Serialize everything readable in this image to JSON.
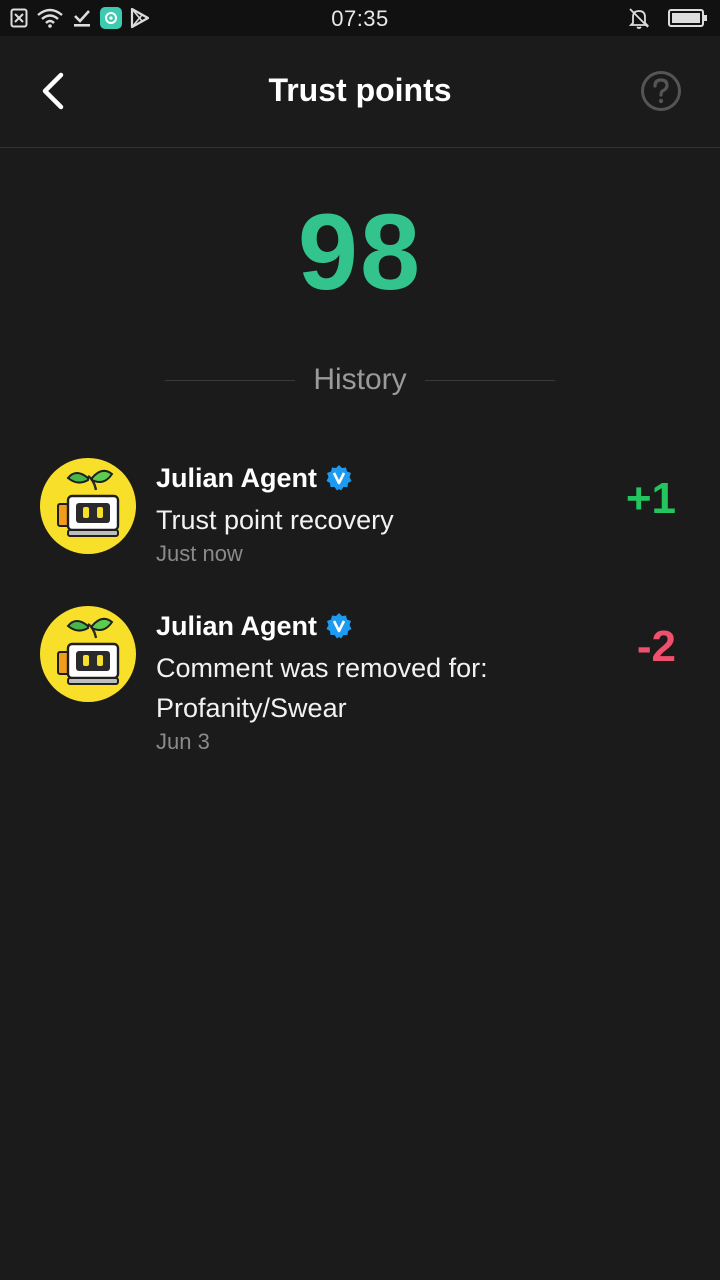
{
  "status_bar": {
    "time": "07:35",
    "icons_left": [
      "close-box-icon",
      "wifi-icon",
      "download-check-icon",
      "app-badge-icon",
      "play-store-icon"
    ],
    "icons_right": [
      "bell-off-icon",
      "battery-icon"
    ]
  },
  "header": {
    "title": "Trust points",
    "back_icon": "chevron-left-icon",
    "help_icon": "question-circle-icon"
  },
  "score": "98",
  "history": {
    "label": "History",
    "items": [
      {
        "author": "Julian Agent",
        "verified": true,
        "message": "Trust point recovery",
        "time": "Just now",
        "delta": "+1",
        "delta_color": "#22c55e"
      },
      {
        "author": "Julian Agent",
        "verified": true,
        "message": "Comment was removed for: Profanity/Swear",
        "time": "Jun 3",
        "delta": "-2",
        "delta_color": "#f0506e"
      }
    ]
  },
  "colors": {
    "background": "#1b1b1b",
    "score": "#33c48d",
    "verified": "#1d9bf0",
    "avatar_bg": "#f8df2a"
  }
}
